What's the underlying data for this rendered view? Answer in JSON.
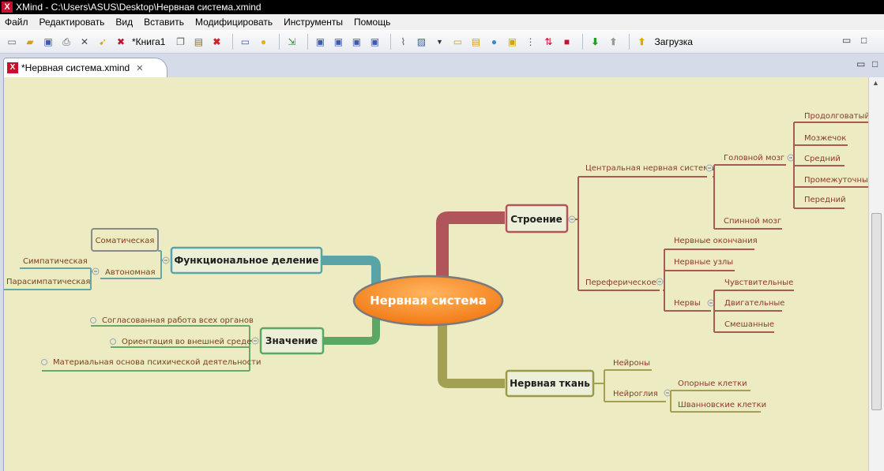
{
  "window": {
    "title": "XMind - C:\\Users\\ASUS\\Desktop\\Нервная система.xmind",
    "app_icon": "X"
  },
  "menu": [
    "Файл",
    "Редактировать",
    "Вид",
    "Вставить",
    "Модифицировать",
    "Инструменты",
    "Помощь"
  ],
  "toolbar": {
    "book_label": "*Книга1",
    "upload_label": "Загрузка"
  },
  "tab": {
    "label": "*Нервная система.xmind"
  },
  "map": {
    "central": "Нервная система",
    "stroenie": {
      "label": "Строение",
      "cns": {
        "label": "Центральная нервная система",
        "brain": {
          "label": "Головной мозг",
          "parts": [
            "Продолговатый",
            "Мозжечок",
            "Средний",
            "Промежуточный",
            "Передний"
          ]
        },
        "spinal": "Спинной мозг"
      },
      "peripheral": {
        "label": "Переферическое",
        "endings": "Нервные окончания",
        "ganglia": "Нервные узлы",
        "nerves": {
          "label": "Нервы",
          "types": [
            "Чувствительные",
            "Двигательные",
            "Смешанные"
          ]
        }
      }
    },
    "tkan": {
      "label": "Нервная ткань",
      "neurons": "Нейроны",
      "glia": {
        "label": "Нейроглия",
        "types": [
          "Опорные клетки",
          "Шванновские клетки"
        ]
      }
    },
    "funkcional": {
      "label": "Функциональное деление",
      "somatic": "Соматическая",
      "autonomic": {
        "label": "Автономная",
        "types": [
          "Симпатическая",
          "Парасимпатическая"
        ]
      }
    },
    "znachenie": {
      "label": "Значение",
      "items": [
        "Согласованная работа всех органов",
        "Ориентация во внешней среде",
        "Материальная основа психической деятельности"
      ]
    }
  },
  "colors": {
    "canvas": "#ecebc1",
    "central_fill": "#f98c2b",
    "stroenie": "#b0565a",
    "tkan": "#9c9a4a",
    "funkcional": "#5aa4a8",
    "znachenie": "#5aa864"
  }
}
